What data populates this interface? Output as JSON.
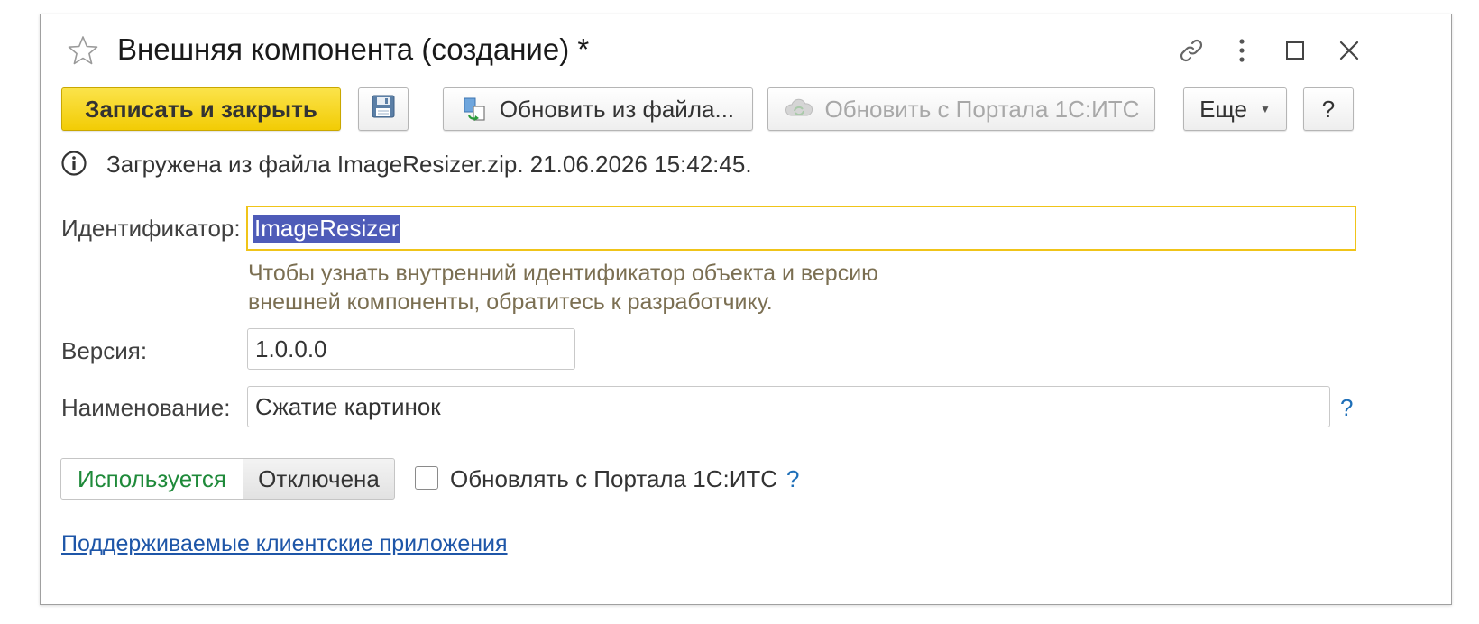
{
  "window": {
    "title": "Внешняя компонента (создание) *"
  },
  "toolbar": {
    "save_close_label": "Записать и закрыть",
    "update_from_file_label": "Обновить из файла...",
    "update_from_portal_label": "Обновить с Портала 1С:ИТС",
    "more_label": "Еще",
    "help_label": "?"
  },
  "info": {
    "message": "Загружена из файла ImageResizer.zip. 21.06.2026 15:42:45."
  },
  "form": {
    "identifier_label": "Идентификатор:",
    "identifier_value": "ImageResizer",
    "identifier_hint_line1": "Чтобы узнать внутренний идентификатор объекта и версию",
    "identifier_hint_line2": "внешней компоненты, обратитесь к разработчику.",
    "version_label": "Версия:",
    "version_value": "1.0.0.0",
    "name_label": "Наименование:",
    "name_value": "Сжатие картинок",
    "name_help": "?"
  },
  "status_toggle": {
    "used_label": "Используется",
    "disabled_label": "Отключена",
    "selected": "Используется"
  },
  "auto_update": {
    "label": "Обновлять с Портала 1С:ИТС",
    "checked": false,
    "help": "?"
  },
  "footer": {
    "link_label": "Поддерживаемые клиентские приложения"
  },
  "colors": {
    "primary_button": "#f5d00e",
    "active_border": "#f0c419",
    "selection": "#4e5bb8",
    "link": "#1e56a8",
    "used_text": "#1f8a3a"
  }
}
